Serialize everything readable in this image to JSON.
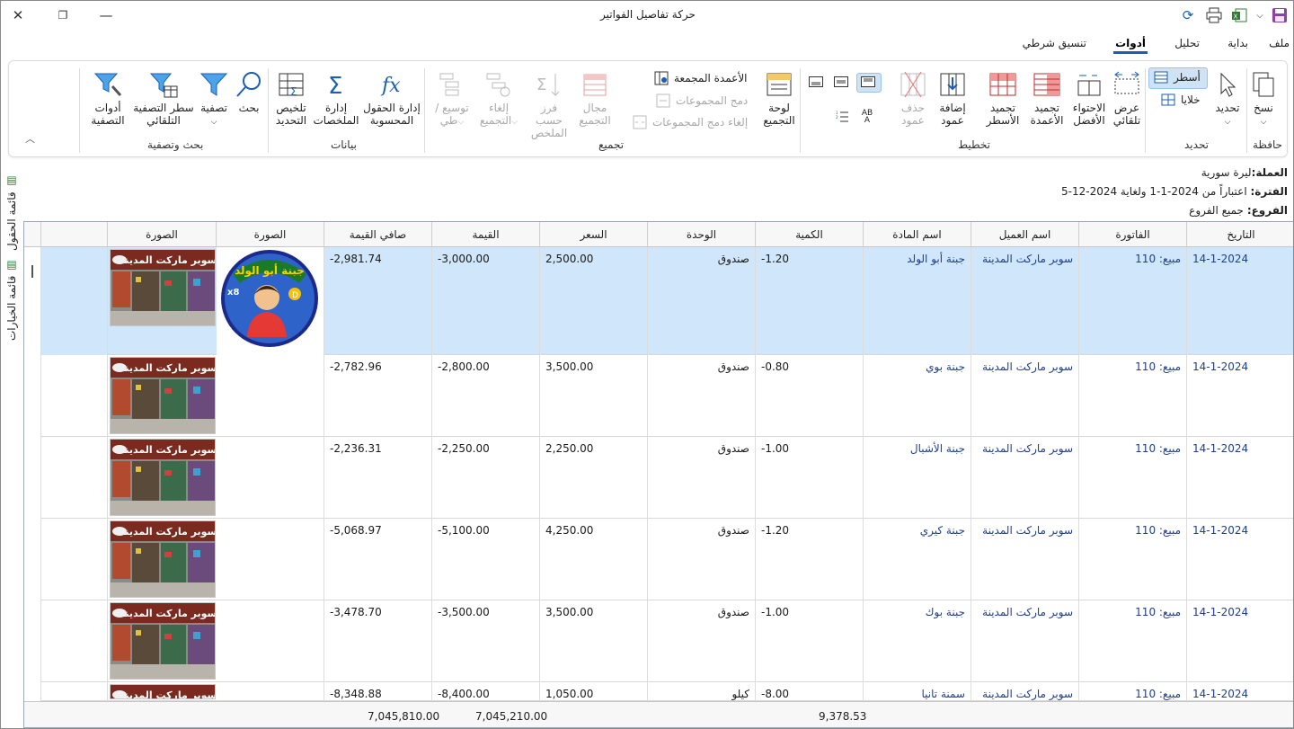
{
  "window": {
    "title": "حركة تفاصيل الفواتير"
  },
  "menu": [
    "ملف",
    "بداية",
    "تحليل",
    "أدوات",
    "تنسيق شرطي"
  ],
  "menu_active": "أدوات",
  "ribbon": {
    "clipboard": {
      "label": "حافظة",
      "copy": "نسخ"
    },
    "selection": {
      "label": "تحديد",
      "select": "تحديد",
      "rows": "أسطر",
      "cells": "خلايا"
    },
    "layout": {
      "label": "تخطيط",
      "auto_width": "عرض تلقائي",
      "best_fit": "الاحتواء الأفضل",
      "freeze_cols": "تجميد الأعمدة",
      "freeze_rows": "تجميد الأسطر",
      "add_col": "إضافة عمود",
      "del_col": "حذف عمود"
    },
    "grouping": {
      "label": "تجميع",
      "group_panel": "لوحة التجميع",
      "grouped_cols": "الأعمدة المجمعة",
      "merge_groups": "دمج المجموعات",
      "unmerge_groups": "إلغاء دمج المجموعات",
      "group_range": "مجال التجميع",
      "sort_summary": "فرز حسب الملخص",
      "ungroup": "إلغاء التجميع",
      "expand": "توسيع / طي"
    },
    "data": {
      "label": "بيانات",
      "calc_fields": "إدارة الحقول المحسوبة",
      "summaries": "إدارة الملخصات",
      "sel_summary": "تلخيص التحديد"
    },
    "filter": {
      "label": "بحث وتصفية",
      "search": "بحث",
      "filter": "تصفية",
      "auto_filter": "سطر التصفية التلقائي",
      "filter_tools": "أدوات التصفية"
    }
  },
  "side_tabs": [
    "قائمة الحقول",
    "قائمة الخيارات"
  ],
  "info": {
    "currency_label": "العملة:",
    "currency": "ليرة سورية",
    "period_label": "الفترة:",
    "period": "اعتباراً من 2024-1-1 ولغاية 2024-12-5",
    "branch_label": "الفروع:",
    "branch": "جميع الفروع"
  },
  "columns": [
    "التاريخ",
    "الفاتورة",
    "اسم العميل",
    "اسم المادة",
    "الكمية",
    "الوحدة",
    "السعر",
    "القيمة",
    "صافي القيمة",
    "الصورة",
    "الصورة"
  ],
  "rows": [
    {
      "date": "14-1-2024",
      "invoice": "مبيع: 110",
      "customer": "سوبر ماركت المدينة",
      "item": "جبنة أبو الولد",
      "qty": "-1.20",
      "unit": "صندوق",
      "price": "2,500.00",
      "value": "-3,000.00",
      "net": "-2,981.74"
    },
    {
      "date": "14-1-2024",
      "invoice": "مبيع: 110",
      "customer": "سوبر ماركت المدينة",
      "item": "جبنة بوي",
      "qty": "-0.80",
      "unit": "صندوق",
      "price": "3,500.00",
      "value": "-2,800.00",
      "net": "-2,782.96"
    },
    {
      "date": "14-1-2024",
      "invoice": "مبيع: 110",
      "customer": "سوبر ماركت المدينة",
      "item": "جبنة الأشبال",
      "qty": "-1.00",
      "unit": "صندوق",
      "price": "2,250.00",
      "value": "-2,250.00",
      "net": "-2,236.31"
    },
    {
      "date": "14-1-2024",
      "invoice": "مبيع: 110",
      "customer": "سوبر ماركت المدينة",
      "item": "جبنة كيري",
      "qty": "-1.20",
      "unit": "صندوق",
      "price": "4,250.00",
      "value": "-5,100.00",
      "net": "-5,068.97"
    },
    {
      "date": "14-1-2024",
      "invoice": "مبيع: 110",
      "customer": "سوبر ماركت المدينة",
      "item": "جبنة بوك",
      "qty": "-1.00",
      "unit": "صندوق",
      "price": "3,500.00",
      "value": "-3,500.00",
      "net": "-3,478.70"
    },
    {
      "date": "14-1-2024",
      "invoice": "مبيع: 110",
      "customer": "سوبر ماركت المدينة",
      "item": "سمنة تانيا",
      "qty": "-8.00",
      "unit": "كيلو",
      "price": "1,050.00",
      "value": "-8,400.00",
      "net": "-8,348.88"
    }
  ],
  "images": {
    "product_logo_text": "جبنة أبو الولد",
    "product_badge": "x8",
    "product_d": "D",
    "shop_sign": "سوبر ماركت المدينة"
  },
  "totals": {
    "qty": "9,378.53",
    "value": "7,045,210.00",
    "net": "7,045,810.00"
  },
  "colors": {
    "accent": "#1a5fb4",
    "selected_row": "#cfe6fb",
    "link_text": "#1f3f8f"
  }
}
